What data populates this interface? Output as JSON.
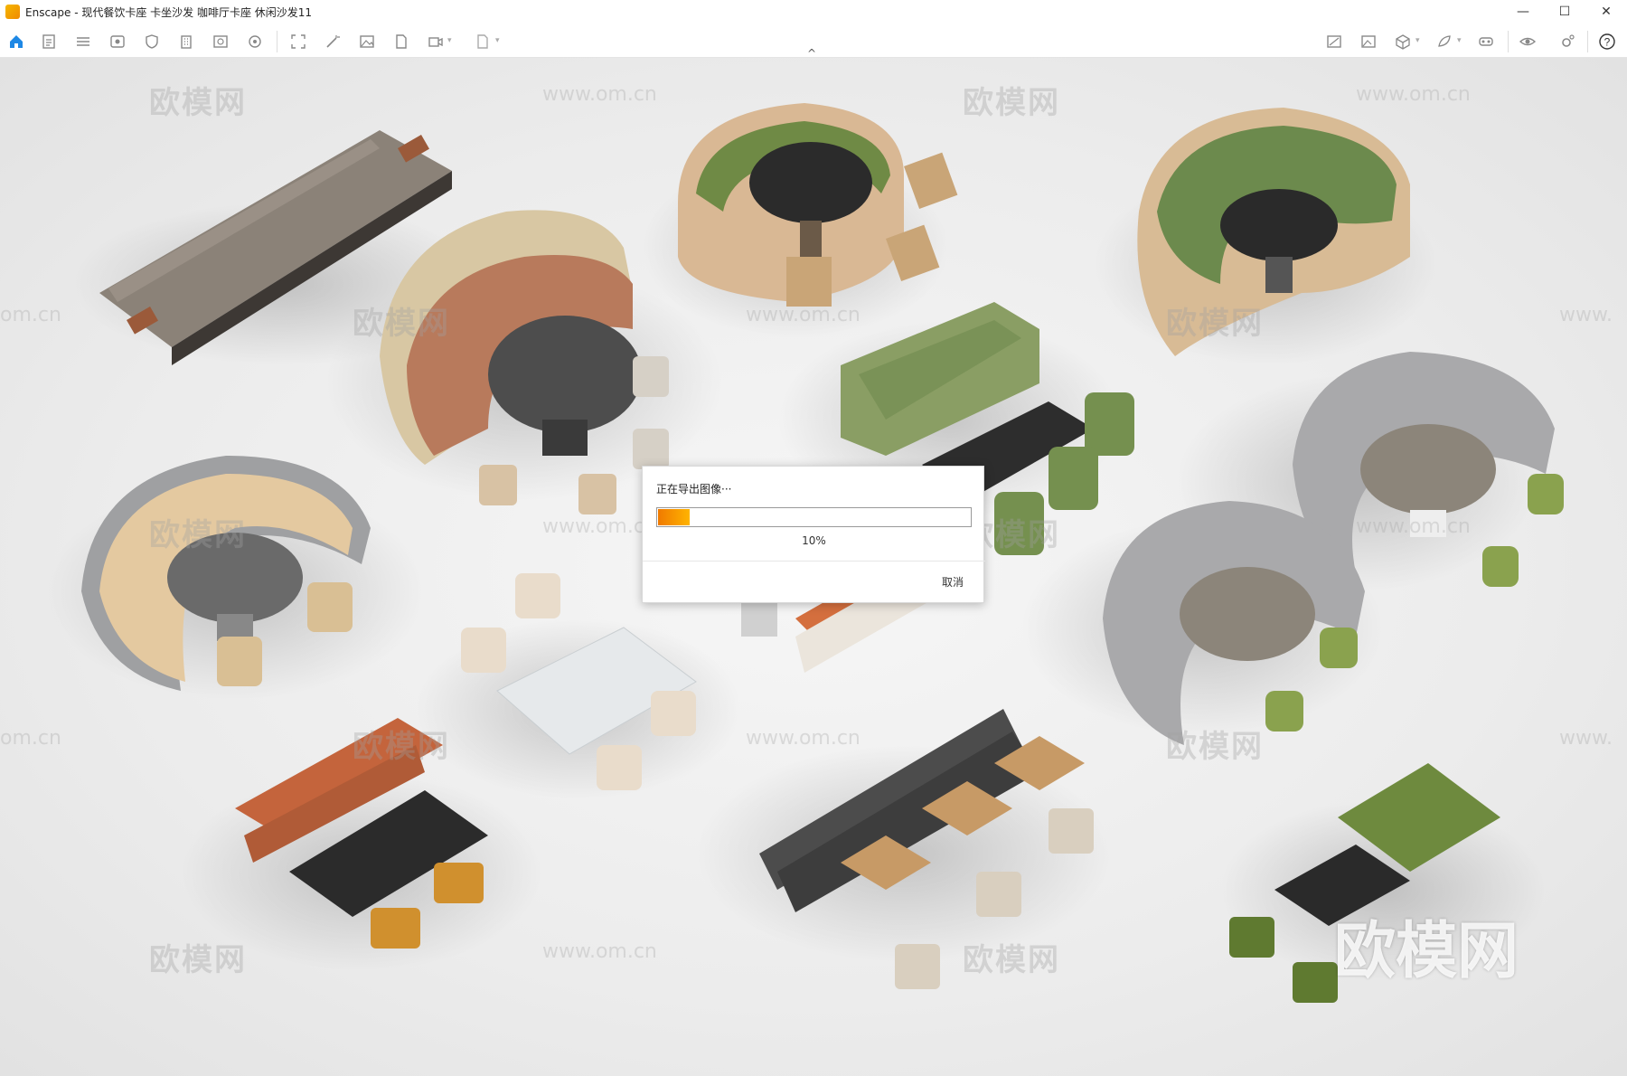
{
  "window": {
    "app_name": "Enscape",
    "title": "Enscape - 现代餐饮卡座 卡坐沙发 咖啡厅卡座  休闲沙发11",
    "minimize": "—",
    "maximize": "☐",
    "close": "✕"
  },
  "toolbar": {
    "left_icons": [
      "home-icon",
      "new-icon",
      "bim-icon",
      "view-icon",
      "shield-icon",
      "building-icon",
      "asset-library-icon",
      "settings-wheel-icon"
    ],
    "right_icons": [
      "screenshot-icon",
      "render-image-icon",
      "3d-box-icon",
      "material-icon",
      "vr-headset-icon",
      "eye-icon",
      "gear-icon",
      "help-icon"
    ],
    "collapse_glyph": "^"
  },
  "watermarks": {
    "brand": "欧模网",
    "url": "www.om.cn",
    "short_url": "om.cn",
    "www": "www."
  },
  "dialog": {
    "title": "正在导出图像···",
    "progress_percent": 10,
    "progress_label": "10%",
    "cancel_label": "取消"
  },
  "colors": {
    "accent": "#f08a00",
    "progress_start": "#f07a00",
    "progress_end": "#ffb400"
  }
}
